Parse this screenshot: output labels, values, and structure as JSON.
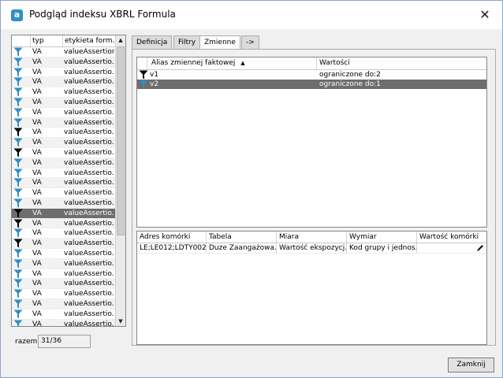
{
  "window": {
    "title": "Podgląd indeksu XBRL Formula",
    "app_icon_letter": "a",
    "close_glyph": "✕"
  },
  "left_list": {
    "columns": [
      "typ",
      "etykieta form..."
    ],
    "rows": [
      {
        "icon": "filter-blue-icon",
        "type": "VA",
        "label": "valueAssertion"
      },
      {
        "icon": "filter-blue-icon",
        "type": "VA",
        "label": "valueAssertio..."
      },
      {
        "icon": "filter-blue-icon",
        "type": "VA",
        "label": "valueAssertio..."
      },
      {
        "icon": "filter-blue-icon",
        "type": "VA",
        "label": "valueAssertio..."
      },
      {
        "icon": "filter-blue-icon",
        "type": "VA",
        "label": "valueAssertio..."
      },
      {
        "icon": "filter-blue-icon",
        "type": "VA",
        "label": "valueAssertio..."
      },
      {
        "icon": "filter-blue-icon",
        "type": "VA",
        "label": "valueAssertio..."
      },
      {
        "icon": "filter-blue-icon",
        "type": "VA",
        "label": "valueAssertio..."
      },
      {
        "icon": "filter-black-icon",
        "type": "VA",
        "label": "valueAssertio..."
      },
      {
        "icon": "filter-blue-icon",
        "type": "VA",
        "label": "valueAssertio..."
      },
      {
        "icon": "filter-black-icon",
        "type": "VA",
        "label": "valueAssertio..."
      },
      {
        "icon": "filter-blue-icon",
        "type": "VA",
        "label": "valueAssertio..."
      },
      {
        "icon": "filter-blue-icon",
        "type": "VA",
        "label": "valueAssertio..."
      },
      {
        "icon": "filter-blue-icon",
        "type": "VA",
        "label": "valueAssertio..."
      },
      {
        "icon": "filter-blue-icon",
        "type": "VA",
        "label": "valueAssertio..."
      },
      {
        "icon": "filter-blue-icon",
        "type": "VA",
        "label": "valueAssertio..."
      },
      {
        "icon": "filter-black-icon",
        "type": "VA",
        "label": "valueAssertio...",
        "selected": true
      },
      {
        "icon": "filter-black-icon",
        "type": "VA",
        "label": "valueAssertio..."
      },
      {
        "icon": "filter-blue-icon",
        "type": "VA",
        "label": "valueAssertio..."
      },
      {
        "icon": "filter-black-icon",
        "type": "VA",
        "label": "valueAssertio..."
      },
      {
        "icon": "filter-blue-icon",
        "type": "VA",
        "label": "valueAssertio..."
      },
      {
        "icon": "filter-blue-icon",
        "type": "VA",
        "label": "valueAssertio..."
      },
      {
        "icon": "filter-blue-icon",
        "type": "VA",
        "label": "valueAssertio..."
      },
      {
        "icon": "filter-blue-icon",
        "type": "VA",
        "label": "valueAssertio..."
      },
      {
        "icon": "filter-blue-icon",
        "type": "VA",
        "label": "valueAssertio..."
      },
      {
        "icon": "filter-blue-icon",
        "type": "VA",
        "label": "valueAssertio..."
      },
      {
        "icon": "filter-blue-icon",
        "type": "VA",
        "label": "valueAssertio..."
      },
      {
        "icon": "filter-blue-icon",
        "type": "VA",
        "label": "valueAssertio..."
      }
    ]
  },
  "total": {
    "label": "razem",
    "value": "31/36"
  },
  "tabs": [
    {
      "label": "Definicja",
      "active": false
    },
    {
      "label": "Filtry",
      "active": false
    },
    {
      "label": "Zmienne",
      "active": true
    },
    {
      "label": "->",
      "active": false
    }
  ],
  "variables_table": {
    "columns": [
      "Alias zmiennej faktowej",
      "Wartości"
    ],
    "sort_indicator": "▲",
    "rows": [
      {
        "icon": "filter-black-icon",
        "alias": "v1",
        "value": "ograniczone do:2",
        "selected": false
      },
      {
        "icon": "filter-blue-icon",
        "alias": "v2",
        "value": "ograniczone do:1",
        "selected": true
      }
    ]
  },
  "details_table": {
    "columns": [
      "Adres komórki",
      "Tabela",
      "Miara",
      "Wymiar",
      "Wartość komórki"
    ],
    "rows": [
      {
        "cells": [
          "LE;LE012;LDTY002:...",
          "Duze Zaangażowa...",
          "Wartość ekspozycj...",
          "Kod grupy i jednos...",
          ""
        ]
      }
    ]
  },
  "buttons": {
    "close_label": "Zamknij"
  },
  "colors": {
    "accent": "#2f8fc6",
    "filter_blue": "#2f8fc6",
    "filter_black": "#000000",
    "selection": "#6d6d6d"
  }
}
